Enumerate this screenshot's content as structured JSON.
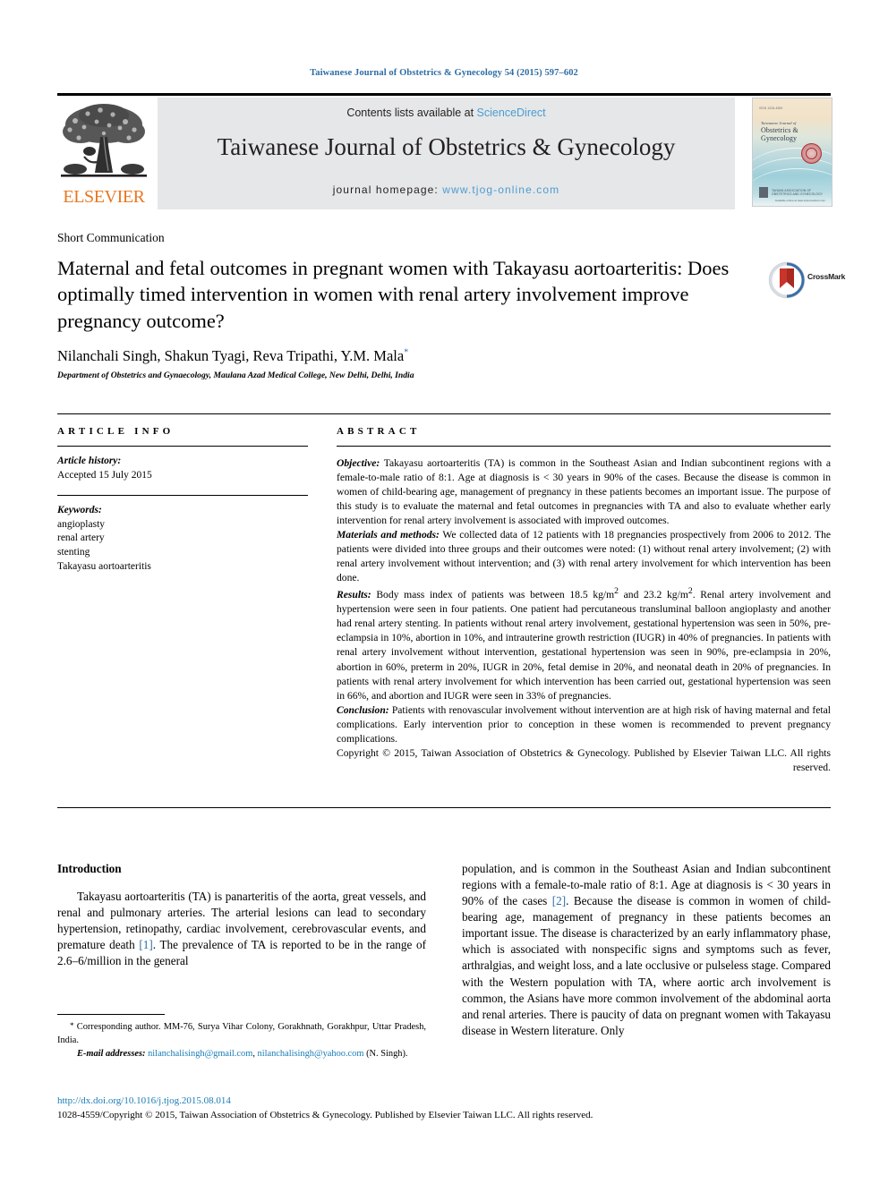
{
  "running_head": "Taiwanese Journal of Obstetrics & Gynecology 54 (2015) 597–602",
  "masthead": {
    "contents_prefix": "Contents lists available at ",
    "sciencedirect": "ScienceDirect",
    "journal_title": "Taiwanese Journal of Obstetrics & Gynecology",
    "homepage_prefix": "journal homepage: ",
    "homepage_url": "www.tjog-online.com",
    "publisher_name": "ELSEVIER",
    "cover": {
      "top_label": "ISSN 1028-4559",
      "pretitle": "Taiwanese Journal of",
      "title": "Obstetrics & Gynecology",
      "footer_text": "TAIWAN ASSOCIATION OF\nOBSTETRICS AND GYNECOLOGY",
      "footer_sub": "Available online at www.sciencedirect.com"
    }
  },
  "article": {
    "type": "Short Communication",
    "title": "Maternal and fetal outcomes in pregnant women with Takayasu aortoarteritis: Does optimally timed intervention in women with renal artery involvement improve pregnancy outcome?",
    "authors": "Nilanchali Singh, Shakun Tyagi, Reva Tripathi, Y.M. Mala",
    "author_marker": "*",
    "affiliation": "Department of Obstetrics and Gynaecology, Maulana Azad Medical College, New Delhi, Delhi, India",
    "crossmark_label": "CrossMark"
  },
  "article_info": {
    "heading": "ARTICLE INFO",
    "history_label": "Article history:",
    "history_value": "Accepted 15 July 2015",
    "keywords_label": "Keywords:",
    "keywords": [
      "angioplasty",
      "renal artery",
      "stenting",
      "Takayasu aortoarteritis"
    ]
  },
  "abstract": {
    "heading": "ABSTRACT",
    "objective_label": "Objective:",
    "objective_text": " Takayasu aortoarteritis (TA) is common in the Southeast Asian and Indian subcontinent regions with a female-to-male ratio of 8:1. Age at diagnosis is < 30 years in 90% of the cases. Because the disease is common in women of child-bearing age, management of pregnancy in these patients becomes an important issue. The purpose of this study is to evaluate the maternal and fetal outcomes in pregnancies with TA and also to evaluate whether early intervention for renal artery involvement is associated with improved outcomes.",
    "materials_label": "Materials and methods:",
    "materials_text": " We collected data of 12 patients with 18 pregnancies prospectively from 2006 to 2012. The patients were divided into three groups and their outcomes were noted: (1) without renal artery involvement; (2) with renal artery involvement without intervention; and (3) with renal artery involvement for which intervention has been done.",
    "results_label": "Results:",
    "results_text_a": " Body mass index of patients was between 18.5 kg/m",
    "results_text_b": " and 23.2 kg/m",
    "results_text_c": ". Renal artery involvement and hypertension were seen in four patients. One patient had percutaneous transluminal balloon angioplasty and another had renal artery stenting. In patients without renal artery involvement, gestational hypertension was seen in 50%, pre-eclampsia in 10%, abortion in 10%, and intrauterine growth restriction (IUGR) in 40% of pregnancies. In patients with renal artery involvement without intervention, gestational hypertension was seen in 90%, pre-eclampsia in 20%, abortion in 60%, preterm in 20%, IUGR in 20%, fetal demise in 20%, and neonatal death in 20% of pregnancies. In patients with renal artery involvement for which intervention has been carried out, gestational hypertension was seen in 66%, and abortion and IUGR were seen in 33% of pregnancies.",
    "conclusion_label": "Conclusion:",
    "conclusion_text": " Patients with renovascular involvement without intervention are at high risk of having maternal and fetal complications. Early intervention prior to conception in these women is recommended to prevent pregnancy complications.",
    "copyright": "Copyright © 2015, Taiwan Association of Obstetrics & Gynecology. Published by Elsevier Taiwan LLC. All rights reserved.",
    "superscript": "2"
  },
  "introduction": {
    "heading": "Introduction",
    "left_text_a": "Takayasu aortoarteritis (TA) is panarteritis of the aorta, great vessels, and renal and pulmonary arteries. The arterial lesions can lead to secondary hypertension, retinopathy, cardiac involvement, cerebrovascular events, and premature death ",
    "left_ref_1": "[1]",
    "left_text_b": ". The prevalence of TA is reported to be in the range of 2.6–6/million in the general",
    "right_text_a": "population, and is common in the Southeast Asian and Indian subcontinent regions with a female-to-male ratio of 8:1. Age at diagnosis is < 30 years in 90% of the cases ",
    "right_ref_2": "[2]",
    "right_text_b": ". Because the disease is common in women of child-bearing age, management of pregnancy in these patients becomes an important issue. The disease is characterized by an early inflammatory phase, which is associated with nonspecific signs and symptoms such as fever, arthralgias, and weight loss, and a late occlusive or pulseless stage. Compared with the Western population with TA, where aortic arch involvement is common, the Asians have more common involvement of the abdominal aorta and renal arteries. There is paucity of data on pregnant women with Takayasu disease in Western literature. Only"
  },
  "footnotes": {
    "corresponding_marker": "*",
    "corresponding_text": " Corresponding author. MM-76, Surya Vihar Colony, Gorakhnath, Gorakhpur, Uttar Pradesh, India.",
    "email_label": "E-mail addresses:",
    "email_1": "nilanchalisingh@gmail.com",
    "email_2": "nilanchalisingh@yahoo.com",
    "email_owner": "(N. Singh)."
  },
  "footer": {
    "doi": "http://dx.doi.org/10.1016/j.tjog.2015.08.014",
    "copyright": "1028-4559/Copyright © 2015, Taiwan Association of Obstetrics & Gynecology. Published by Elsevier Taiwan LLC. All rights reserved."
  }
}
